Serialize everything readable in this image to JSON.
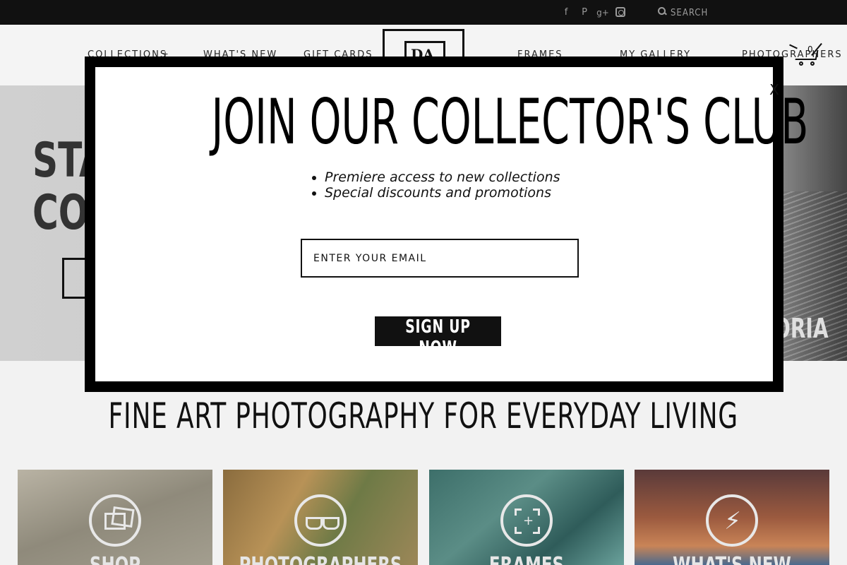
{
  "topbar": {
    "social": [
      {
        "name": "facebook-icon",
        "glyph": "f"
      },
      {
        "name": "pinterest-icon",
        "glyph": "P"
      },
      {
        "name": "google-plus-icon",
        "glyph": "g+"
      },
      {
        "name": "instagram-icon",
        "glyph": ""
      }
    ],
    "search_placeholder": "SEARCH"
  },
  "nav": {
    "collections": "COLLECTIONS",
    "collections_toggle": "+",
    "whats_new": "WHAT'S NEW",
    "gift_cards": "GIFT CARDS",
    "logo_letters": "DA",
    "frames": "FRAMES",
    "my_gallery": "MY GALLERY",
    "photographers": "PHOTOGRAPHERS",
    "cart_count": "0"
  },
  "hero": {
    "title": "STA\nCO",
    "caption": "ORIA"
  },
  "tagline": "FINE ART PHOTOGRAPHY FOR EVERYDAY LIVING",
  "tiles": [
    {
      "label": "SHOP",
      "icon": "photos-icon"
    },
    {
      "label": "PHOTOGRAPHERS",
      "icon": "glasses-icon"
    },
    {
      "label": "FRAMES",
      "icon": "frame-icon"
    },
    {
      "label": "WHAT'S NEW",
      "icon": "lightning-icon"
    }
  ],
  "modal": {
    "close": "X",
    "title": "JOIN OUR COLLECTOR'S CLUB",
    "benefits": [
      "Premiere access to new collections",
      "Special discounts and promotions"
    ],
    "email_placeholder": "ENTER YOUR EMAIL",
    "signup_label": "SIGN UP NOW"
  },
  "colors": {
    "topbar": "#111111",
    "modal_border": "#000000",
    "button": "#111111"
  }
}
